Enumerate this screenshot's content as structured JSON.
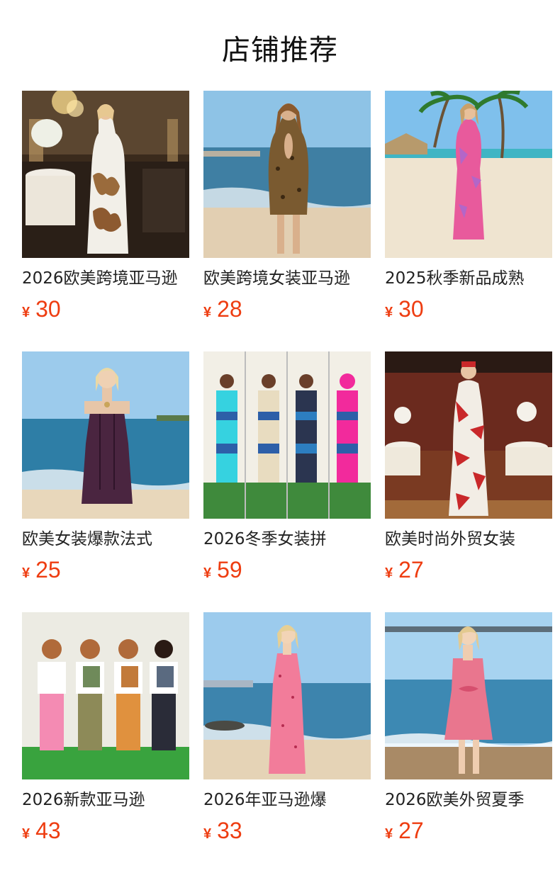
{
  "header": {
    "title": "店铺推荐"
  },
  "products": [
    {
      "name": "2026欧美跨境亚马逊",
      "currency": "¥",
      "price": "30",
      "image": "model-white-floral-dress-banquet"
    },
    {
      "name": "欧美跨境女装亚马逊",
      "currency": "¥",
      "price": "28",
      "image": "model-leopard-halter-dress-beach"
    },
    {
      "name": "2025秋季新品成熟",
      "currency": "¥",
      "price": "30",
      "image": "model-pink-maxi-dress-palm-beach"
    },
    {
      "name": "欧美女装爆款法式",
      "currency": "¥",
      "price": "25",
      "image": "model-purple-halter-dress-beach"
    },
    {
      "name": "2026冬季女装拼",
      "currency": "¥",
      "price": "59",
      "image": "four-models-tracksuits-collage"
    },
    {
      "name": "欧美时尚外贸女装",
      "currency": "¥",
      "price": "27",
      "image": "model-red-leaf-print-dress-ballroom"
    },
    {
      "name": "2026新款亚马逊",
      "currency": "¥",
      "price": "43",
      "image": "four-models-cargo-pants-flower-wall"
    },
    {
      "name": "2026年亚马逊爆",
      "currency": "¥",
      "price": "33",
      "image": "model-pink-floral-maxi-dress-beach"
    },
    {
      "name": "2026欧美外贸夏季",
      "currency": "¥",
      "price": "27",
      "image": "model-pink-floral-mini-dress-beach"
    }
  ]
}
